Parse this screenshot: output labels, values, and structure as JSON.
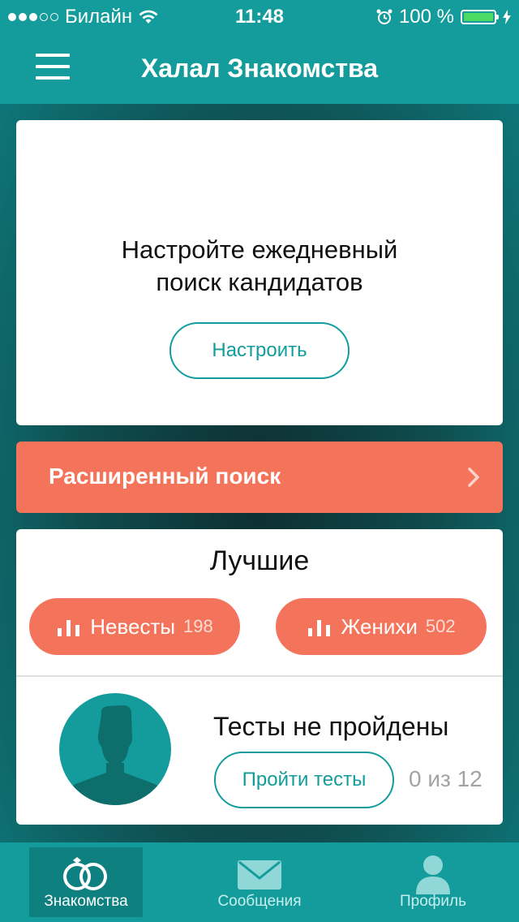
{
  "status_bar": {
    "carrier": "Билайн",
    "time": "11:48",
    "battery_percent": "100 %"
  },
  "navbar": {
    "title": "Халал Знакомства"
  },
  "daily_search_card": {
    "prompt_line1": "Настройте ежедневный",
    "prompt_line2": "поиск кандидатов",
    "button_label": "Настроить"
  },
  "advanced_search": {
    "label": "Расширенный поиск"
  },
  "best_card": {
    "title": "Лучшие",
    "brides": {
      "label": "Невесты",
      "count": "198"
    },
    "grooms": {
      "label": "Женихи",
      "count": "502"
    },
    "tests_title": "Тесты не пройдены",
    "tests_button": "Пройти тесты",
    "tests_progress": "0 из 12"
  },
  "tabs": [
    {
      "label": "Знакомства",
      "icon": "rings-icon",
      "active": true
    },
    {
      "label": "Сообщения",
      "icon": "envelope-icon",
      "active": false
    },
    {
      "label": "Профиль",
      "icon": "person-icon",
      "active": false
    }
  ],
  "colors": {
    "primary": "#139c9b",
    "accent": "#f3745a",
    "battery": "#4cd964"
  }
}
